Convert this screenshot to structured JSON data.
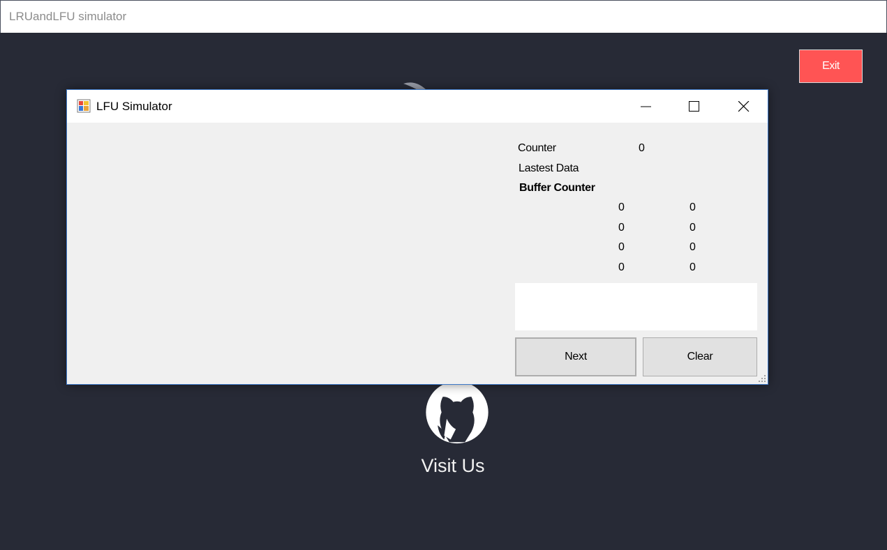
{
  "window": {
    "title": "LRUandLFU simulator"
  },
  "exit_button": {
    "label": "Exit",
    "color": "#ff5454"
  },
  "background": {
    "color": "#272a36"
  },
  "github": {
    "icon": "github-icon",
    "label": "Visit Us"
  },
  "dialog": {
    "title": "LFU Simulator",
    "icon": "app-icon",
    "controls": {
      "minimize": "minimize-icon",
      "maximize": "maximize-icon",
      "close": "close-icon"
    },
    "counter": {
      "label": "Counter",
      "value": "0"
    },
    "latest_data": {
      "label": "Lastest Data",
      "value": ""
    },
    "buffer_counter": {
      "title": "Buffer Counter",
      "rows": [
        {
          "value": "0",
          "count": "0"
        },
        {
          "value": "0",
          "count": "0"
        },
        {
          "value": "0",
          "count": "0"
        },
        {
          "value": "0",
          "count": "0"
        }
      ]
    },
    "output_text": "",
    "buttons": {
      "next": "Next",
      "clear": "Clear"
    }
  }
}
